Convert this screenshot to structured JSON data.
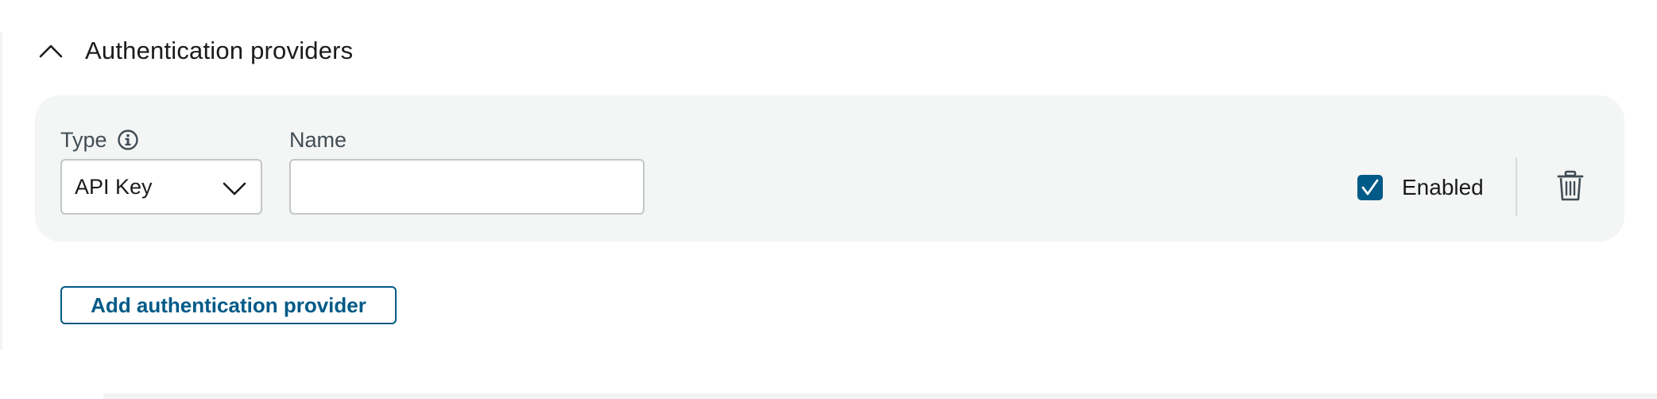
{
  "section": {
    "title": "Authentication providers",
    "collapse_icon": "chevron-up-icon"
  },
  "provider": {
    "type_label": "Type",
    "type_info_icon": "info-icon",
    "type_value": "API Key",
    "name_label": "Name",
    "name_value": "",
    "enabled_label": "Enabled",
    "enabled_checked": true,
    "delete_icon": "trash-icon"
  },
  "actions": {
    "add_label": "Add authentication provider"
  },
  "colors": {
    "accent": "#005a87",
    "card_bg": "#f4f5f5",
    "border": "#c2c6c8",
    "text": "#1b1b1b",
    "label_text": "#414d55"
  }
}
